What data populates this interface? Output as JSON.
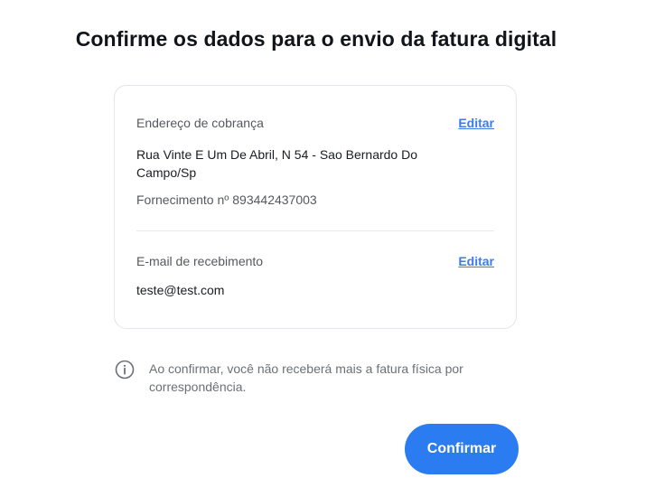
{
  "title": "Confirme os dados para o envio da fatura digital",
  "billing": {
    "label": "Endereço de cobrança",
    "edit_label": "Editar",
    "address": "Rua Vinte E Um De Abril, N 54 - Sao Bernardo Do Campo/Sp",
    "supply_number": "Fornecimento nº 893442437003"
  },
  "email_section": {
    "label": "E-mail de recebimento",
    "edit_label": "Editar",
    "email": "teste@test.com"
  },
  "notice": {
    "icon": "info-icon",
    "text": "Ao confirmar, você não receberá mais a fatura física por correspondência."
  },
  "confirm_button": {
    "label": "Confirmar"
  },
  "colors": {
    "accent": "#2b7cf0",
    "link": "#3b7ce6"
  }
}
